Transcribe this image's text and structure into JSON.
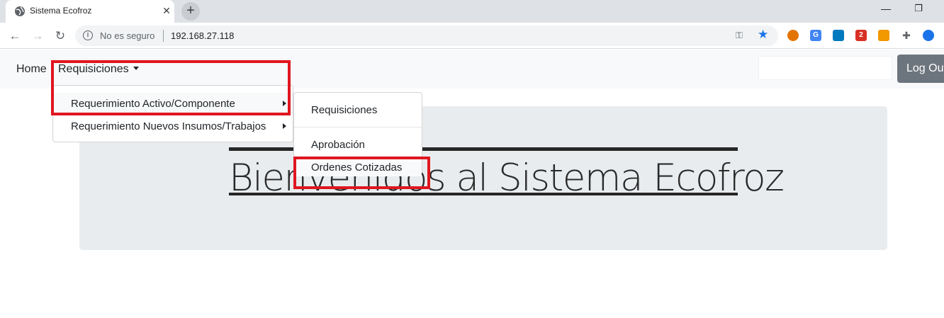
{
  "browser": {
    "tab_title": "Sistema Ecofroz",
    "tab_close": "✕",
    "new_tab": "+",
    "minimize": "—",
    "restore": "❐",
    "back": "←",
    "forward": "→",
    "reload": "↻",
    "security_text": "No es seguro",
    "url": "192.168.27.118"
  },
  "navbar": {
    "home": "Home",
    "requisiciones": "Requisiciones",
    "logout": "Log Out"
  },
  "dropdown": {
    "items": [
      "Requerimiento Activo/Componente",
      "Requerimiento Nuevos Insumos/Trabajos"
    ]
  },
  "submenu": {
    "items": [
      "Requisiciones",
      "Aprobación",
      "Ordenes Cotizadas"
    ]
  },
  "main": {
    "welcome": "Bienvenidos al Sistema Ecofroz"
  },
  "colors": {
    "highlight": "#e0161f",
    "logout_bg": "#6c757d",
    "jumbotron_bg": "#e9ecef"
  }
}
